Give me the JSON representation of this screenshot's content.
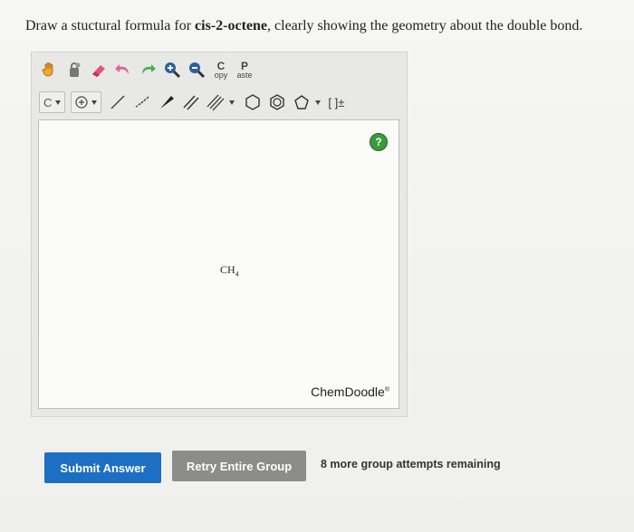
{
  "prompt": {
    "prefix": "Draw a stuctural formula for ",
    "compound": "cis-2-octene",
    "suffix": ", clearly showing the geometry about the double bond."
  },
  "toolbar": {
    "copy_big": "C",
    "copy_small": "opy",
    "paste_big": "P",
    "paste_small": "aste",
    "element_label": "C",
    "charge_label": "[ ]±"
  },
  "canvas": {
    "help_label": "?",
    "molecule_main": "CH",
    "molecule_sub": "4",
    "brand": "ChemDoodle",
    "brand_mark": "®"
  },
  "actions": {
    "submit_label": "Submit Answer",
    "retry_label": "Retry Entire Group",
    "attempts_text": "8 more group attempts remaining"
  }
}
